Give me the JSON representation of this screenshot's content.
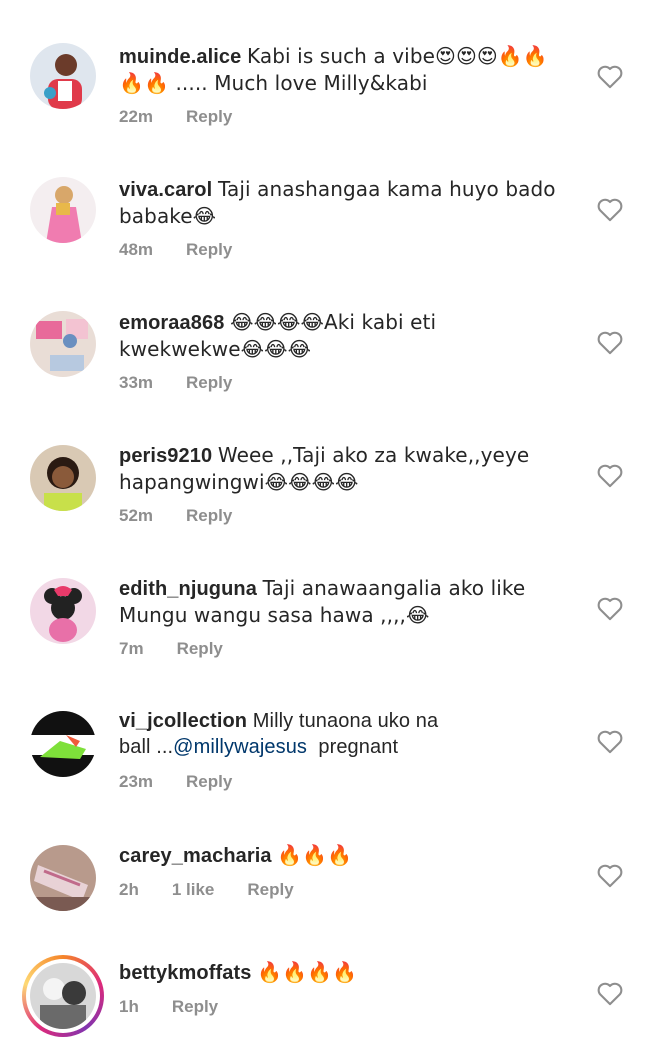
{
  "comments": [
    {
      "username": "muinde.alice",
      "text_line1": "Kabi is such a vibe😍😍😍🔥🔥",
      "text_line2": "🔥🔥 ..... Much love Milly&kabi",
      "time": "22m",
      "reply": "Reply"
    },
    {
      "username": "viva.carol",
      "text_line1": "Taji anashangaa kama huyo bado",
      "text_line2": "babake😂",
      "time": "48m",
      "reply": "Reply"
    },
    {
      "username": "emoraa868",
      "text_line1": "😂😂😂😂Aki kabi eti",
      "text_line2": "kwekwekwe😂😂😂",
      "time": "33m",
      "reply": "Reply"
    },
    {
      "username": "peris9210",
      "text_line1": "Weee ,,Taji ako za kwake,,yeye",
      "text_line2": "hapangwingwi😂😂😂😂",
      "time": "52m",
      "reply": "Reply"
    },
    {
      "username": "edith_njuguna",
      "text_line1": "Taji anawaangalia ako like",
      "text_line2": "Mungu wangu sasa hawa ,,,,😂",
      "time": "7m",
      "reply": "Reply"
    },
    {
      "username": "vi_jcollection",
      "text_line1": "Milly tunaona uko na",
      "text_line2_pre": "ball ...",
      "mention": "@millywajesus",
      "text_line2_post": "  pregnant",
      "time": "23m",
      "reply": "Reply"
    },
    {
      "username": "carey_macharia",
      "text_line1": "🔥🔥🔥",
      "time": "2h",
      "likes": "1 like",
      "reply": "Reply"
    },
    {
      "username": "bettykmoffats",
      "text_line1": "🔥🔥🔥🔥",
      "time": "1h",
      "reply": "Reply"
    }
  ],
  "icons": {
    "like": "heart-outline-icon"
  },
  "colors": {
    "username": "#262626",
    "meta": "#8e8e8e",
    "mention": "#00376b",
    "heart": "#8e8e8e"
  }
}
